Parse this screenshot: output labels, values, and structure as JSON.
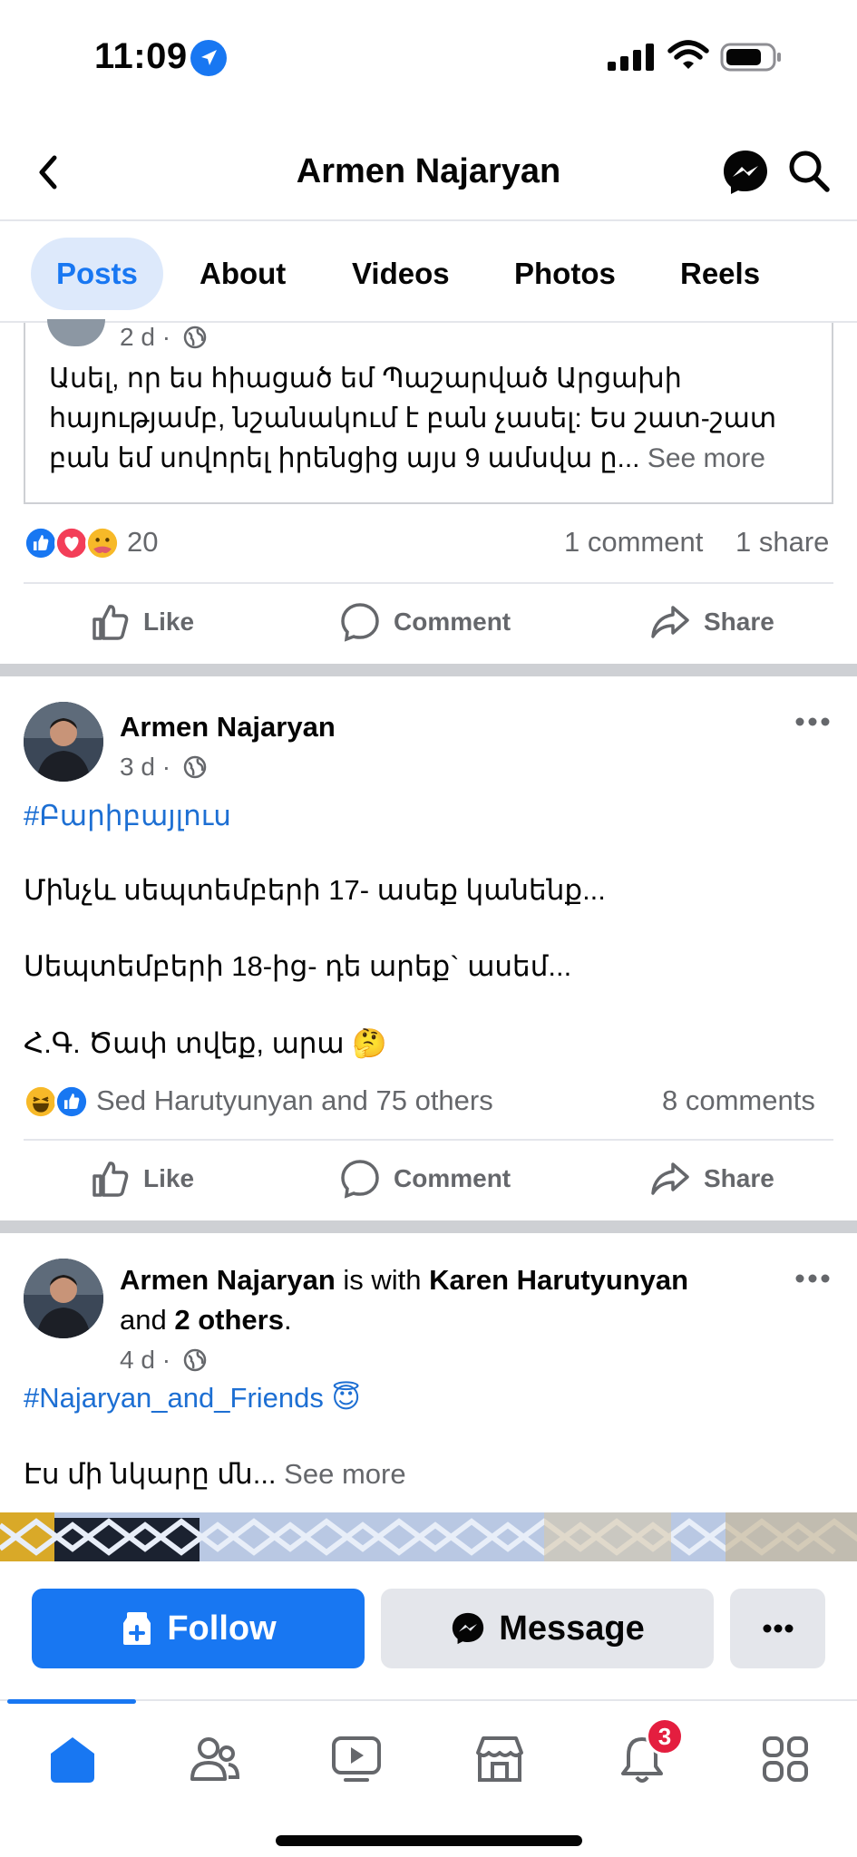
{
  "status_bar": {
    "time": "11:09"
  },
  "header": {
    "title": "Armen Najaryan"
  },
  "tabs": [
    {
      "label": "Posts",
      "active": true
    },
    {
      "label": "About",
      "active": false
    },
    {
      "label": "Videos",
      "active": false
    },
    {
      "label": "Photos",
      "active": false
    },
    {
      "label": "Reels",
      "active": false
    }
  ],
  "shared_post": {
    "time": "2 d ·",
    "text": "Ասել, որ ես հիացած եմ Պաշարված Արցախի հայությամբ, նշանակում է բան չասել: Ես շատ-շատ բան եմ սովորել իրենցից այս 9 ամսվա ը...",
    "see_more": "See more"
  },
  "post1_stats": {
    "reactions_count": "20",
    "comments": "1 comment",
    "shares": "1 share"
  },
  "actions": {
    "like": "Like",
    "comment": "Comment",
    "share": "Share"
  },
  "post2": {
    "author": "Armen Najaryan",
    "time": "3 d ·",
    "hashtag": "#Բարիբայլուս",
    "line1": "Մինչև սեպտեմբերի 17- ասեք կանենք...",
    "line2": "Սեպտեմբերի 18-ից- դե արեք`  ասեմ...",
    "line3": "Հ.Գ. Ծափ տվեք, արա",
    "line3_emoji": "🤔",
    "reactions_text": "Sed Harutyunyan and 75 others",
    "comments": "8 comments"
  },
  "post3": {
    "author": "Armen Najaryan",
    "with_text": " is with ",
    "tagged": "Karen Harutyunyan",
    "and_text": "and ",
    "others": "2 others",
    "period": ".",
    "time": "4 d ·",
    "hashtag": "#Najaryan_and_Friends",
    "hashtag_emoji": "😇",
    "text": "Էս մի նկարը մն...",
    "see_more": "See more"
  },
  "profile_actions": {
    "follow": "Follow",
    "message": "Message"
  },
  "nav": {
    "items": [
      "home-icon",
      "friends-icon",
      "video-icon",
      "marketplace-icon",
      "notifications-icon",
      "menu-icon"
    ],
    "notification_badge": "3"
  },
  "colors": {
    "accent": "#1877f2",
    "badge": "#e41e3f",
    "text_secondary": "#65676b"
  }
}
